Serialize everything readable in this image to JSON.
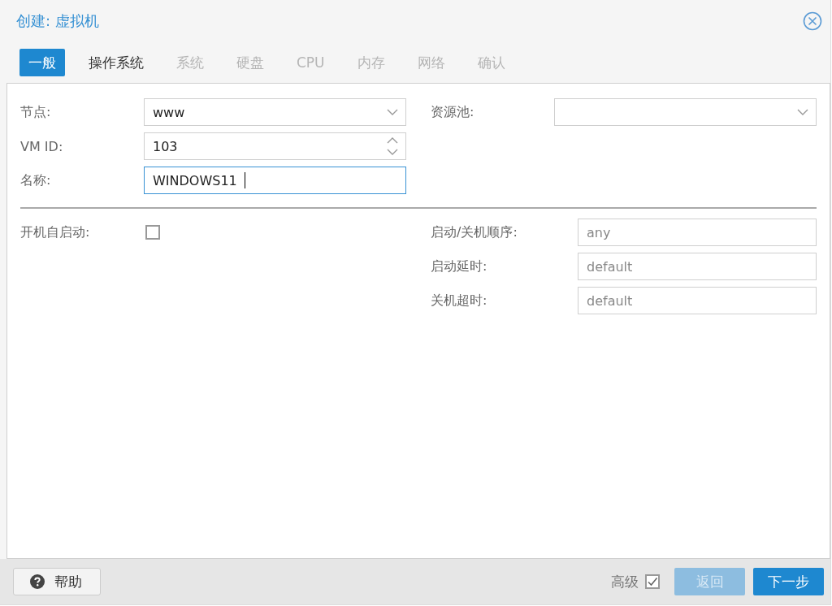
{
  "window": {
    "title": "创建: 虚拟机"
  },
  "tabs": [
    {
      "label": "一般",
      "selected": true,
      "disabled": false
    },
    {
      "label": "操作系统",
      "selected": false,
      "disabled": false
    },
    {
      "label": "系统",
      "selected": false,
      "disabled": true
    },
    {
      "label": "硬盘",
      "selected": false,
      "disabled": true
    },
    {
      "label": "CPU",
      "selected": false,
      "disabled": true
    },
    {
      "label": "内存",
      "selected": false,
      "disabled": true
    },
    {
      "label": "网络",
      "selected": false,
      "disabled": true
    },
    {
      "label": "确认",
      "selected": false,
      "disabled": true
    }
  ],
  "general": {
    "left": [
      {
        "label": "节点:",
        "kind": "combo",
        "value": "www"
      },
      {
        "label": "VM ID:",
        "kind": "spinner",
        "value": "103"
      },
      {
        "label": "名称:",
        "kind": "text",
        "value": "WINDOWS11",
        "focused": true
      }
    ],
    "right": [
      {
        "label": "资源池:",
        "kind": "combo"
      }
    ]
  },
  "options": {
    "left": [
      {
        "label": "开机自启动:",
        "kind": "checkbox",
        "checked": false
      }
    ],
    "right": [
      {
        "label": "启动/关机顺序:",
        "kind": "text",
        "placeholder": "any"
      },
      {
        "label": "启动延时:",
        "kind": "text",
        "placeholder": "default"
      },
      {
        "label": "关机超时:",
        "kind": "text",
        "placeholder": "default"
      }
    ]
  },
  "footer": {
    "help": "帮助",
    "advanced": {
      "label": "高级",
      "checked": true
    },
    "buttons": [
      {
        "label": "返回",
        "disabled": true
      },
      {
        "label": "下一步",
        "disabled": false
      }
    ]
  }
}
